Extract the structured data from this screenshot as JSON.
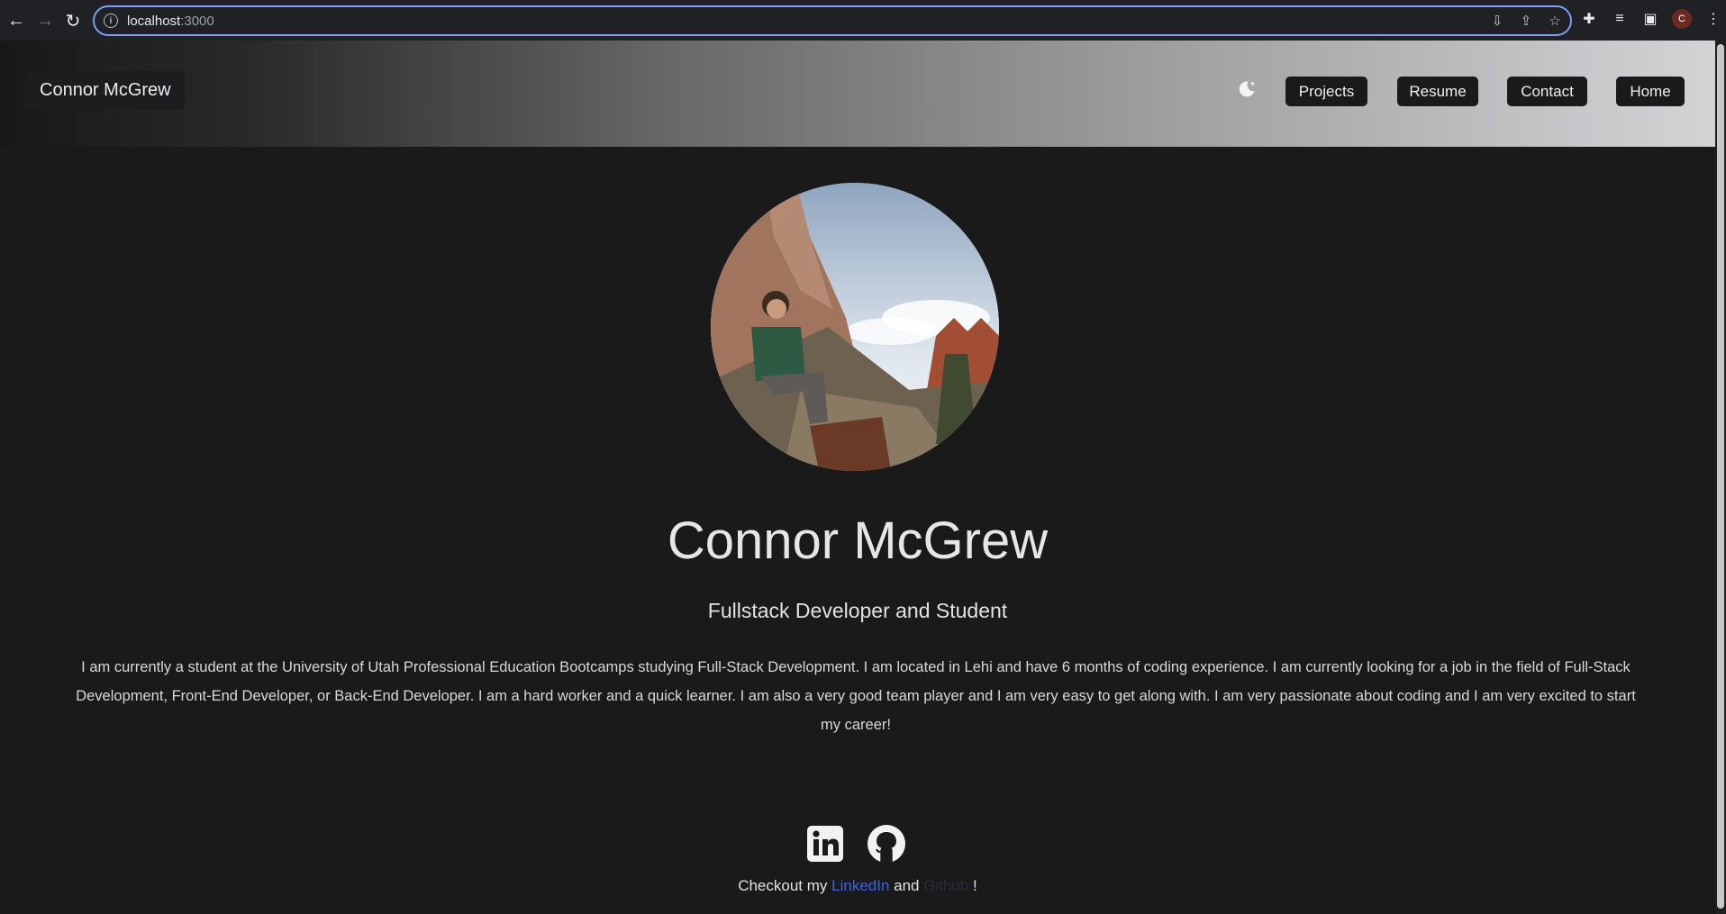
{
  "browser": {
    "url_host": "localhost",
    "url_port": ":3000",
    "profile_initial": "C",
    "icons": [
      "back-icon",
      "forward-icon",
      "reload-icon",
      "info-icon",
      "install-icon",
      "share-icon",
      "star-icon",
      "extensions-icon",
      "reading-list-icon",
      "side-panel-icon",
      "menu-icon"
    ]
  },
  "header": {
    "brand": "Connor McGrew",
    "nav": [
      "Projects",
      "Resume",
      "Contact",
      "Home"
    ]
  },
  "hero": {
    "name": "Connor McGrew",
    "subtitle": "Fullstack Developer and Student",
    "bio": "I am currently a student at the University of Utah Professional Education Bootcamps studying Full-Stack Development. I am located in Lehi and have 6 months of coding experience. I am currently looking for a job in the field of Full-Stack Development, Front-End Developer, or Back-End Developer. I am a hard worker and a quick learner. I am also a very good team player and I am very easy to get along with. I am very passionate about coding and I am very excited to start my career!"
  },
  "footer": {
    "prefix": "Checkout my ",
    "linkedin": "LinkedIn",
    "and": " and ",
    "github": "Github",
    "suffix": " !"
  }
}
